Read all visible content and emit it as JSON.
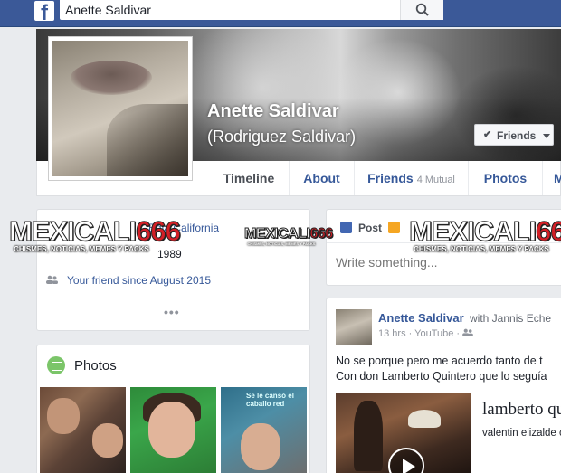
{
  "topbar": {
    "logo_letter": "f",
    "search_value": "Anette Saldivar",
    "search_icon": "search-icon"
  },
  "profile": {
    "name": "Anette Saldivar",
    "alternate_name": "(Rodriguez Saldivar)",
    "friends_button": "Friends",
    "friends_check": "✔"
  },
  "nav": {
    "tabs": [
      {
        "label": "Timeline",
        "sub": ""
      },
      {
        "label": "About",
        "sub": ""
      },
      {
        "label": "Friends",
        "sub": "4 Mutual"
      },
      {
        "label": "Photos",
        "sub": ""
      },
      {
        "label": "M",
        "sub": ""
      }
    ]
  },
  "intro": {
    "location": "Baja California",
    "year": "1989",
    "friend_since": "Your friend since August 2015",
    "more": "•••"
  },
  "photos": {
    "title": "Photos",
    "thumb3_caption": "Se le cansó el caballo red"
  },
  "composer": {
    "post_label": "Post",
    "placeholder": "Write something..."
  },
  "post": {
    "author": "Anette Saldivar",
    "with_text": "with Jannis Eche",
    "meta": "13 hrs · YouTube · ",
    "line1": "No se porque pero me acuerdo tanto de t",
    "line2": "Con don Lamberto Quintero que lo seguía",
    "link_title": "lamberto qu",
    "link_sub": "valentin elizalde c"
  },
  "watermarks": {
    "large_a": "MEXICALI",
    "large_b": "666",
    "large_tag": "CHISMES, NOTICIAS, MEMES Y PACKS",
    "small_a": "MEXICALI",
    "small_b": "666",
    "small_tag": "CHISMES, NOTICIAS, MEMES Y PACKS"
  },
  "colors": {
    "brand": "#3b5998",
    "link": "#365899",
    "background": "#e9ebee",
    "watermark_red": "#d31f26"
  }
}
